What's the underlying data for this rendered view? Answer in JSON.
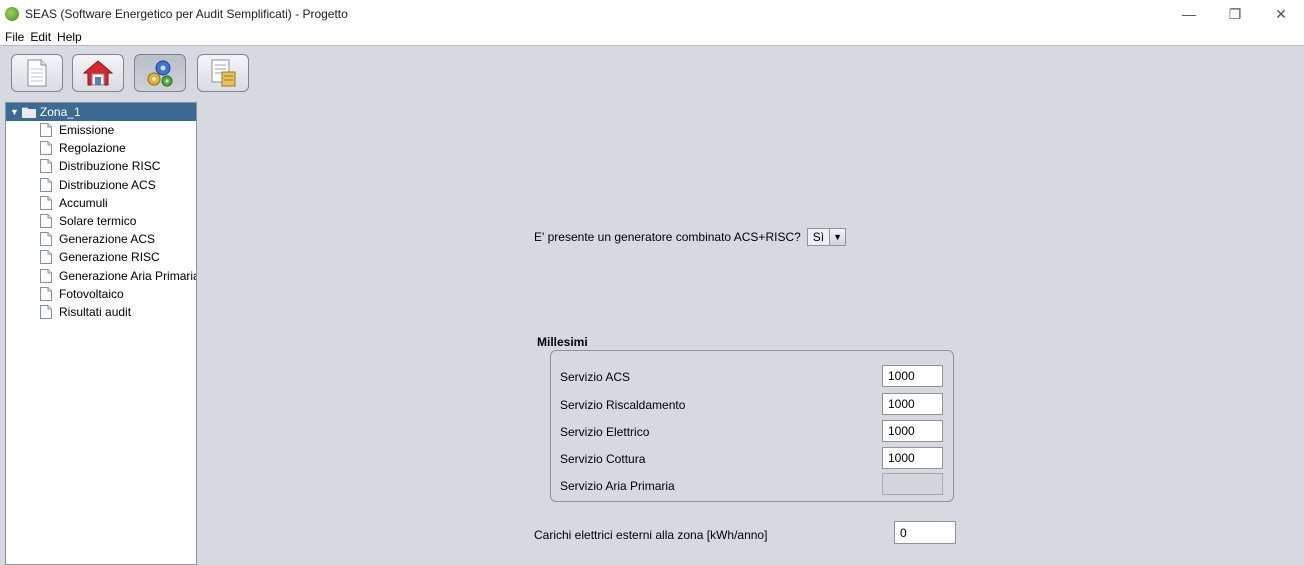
{
  "window": {
    "title": "SEAS (Software Energetico per Audit Semplificati) - Progetto",
    "controls": [
      "—",
      "❐",
      "✕"
    ]
  },
  "menu": [
    "File",
    "Edit",
    "Help"
  ],
  "toolbar": {
    "buttons": [
      {
        "icon": "document-icon"
      },
      {
        "icon": "home-icon"
      },
      {
        "icon": "gears-icon",
        "active": true
      },
      {
        "icon": "report-icon"
      }
    ]
  },
  "tree": {
    "root": "Zona_1",
    "items": [
      "Emissione",
      "Regolazione",
      "Distribuzione RISC",
      "Distribuzione ACS",
      "Accumuli",
      "Solare termico",
      "Generazione ACS",
      "Generazione RISC",
      "Generazione Aria Primaria",
      "Fotovoltaico",
      "Risultati audit"
    ]
  },
  "main": {
    "question": "E' presente un generatore combinato ACS+RISC?",
    "combo_value": "Sì",
    "millesimi": {
      "title": "Millesimi",
      "rows": [
        {
          "label": "Servizio ACS",
          "value": "1000"
        },
        {
          "label": "Servizio Riscaldamento",
          "value": "1000"
        },
        {
          "label": "Servizio Elettrico",
          "value": "1000"
        },
        {
          "label": "Servizio Cottura",
          "value": "1000"
        },
        {
          "label": "Servizio Aria Primaria",
          "value": ""
        }
      ]
    },
    "carichi_label": "Carichi elettrici esterni alla zona  [kWh/anno]",
    "carichi_value": "0"
  },
  "colors": {
    "background": "#d6d9df",
    "tree_selection": "#3b6b94"
  }
}
